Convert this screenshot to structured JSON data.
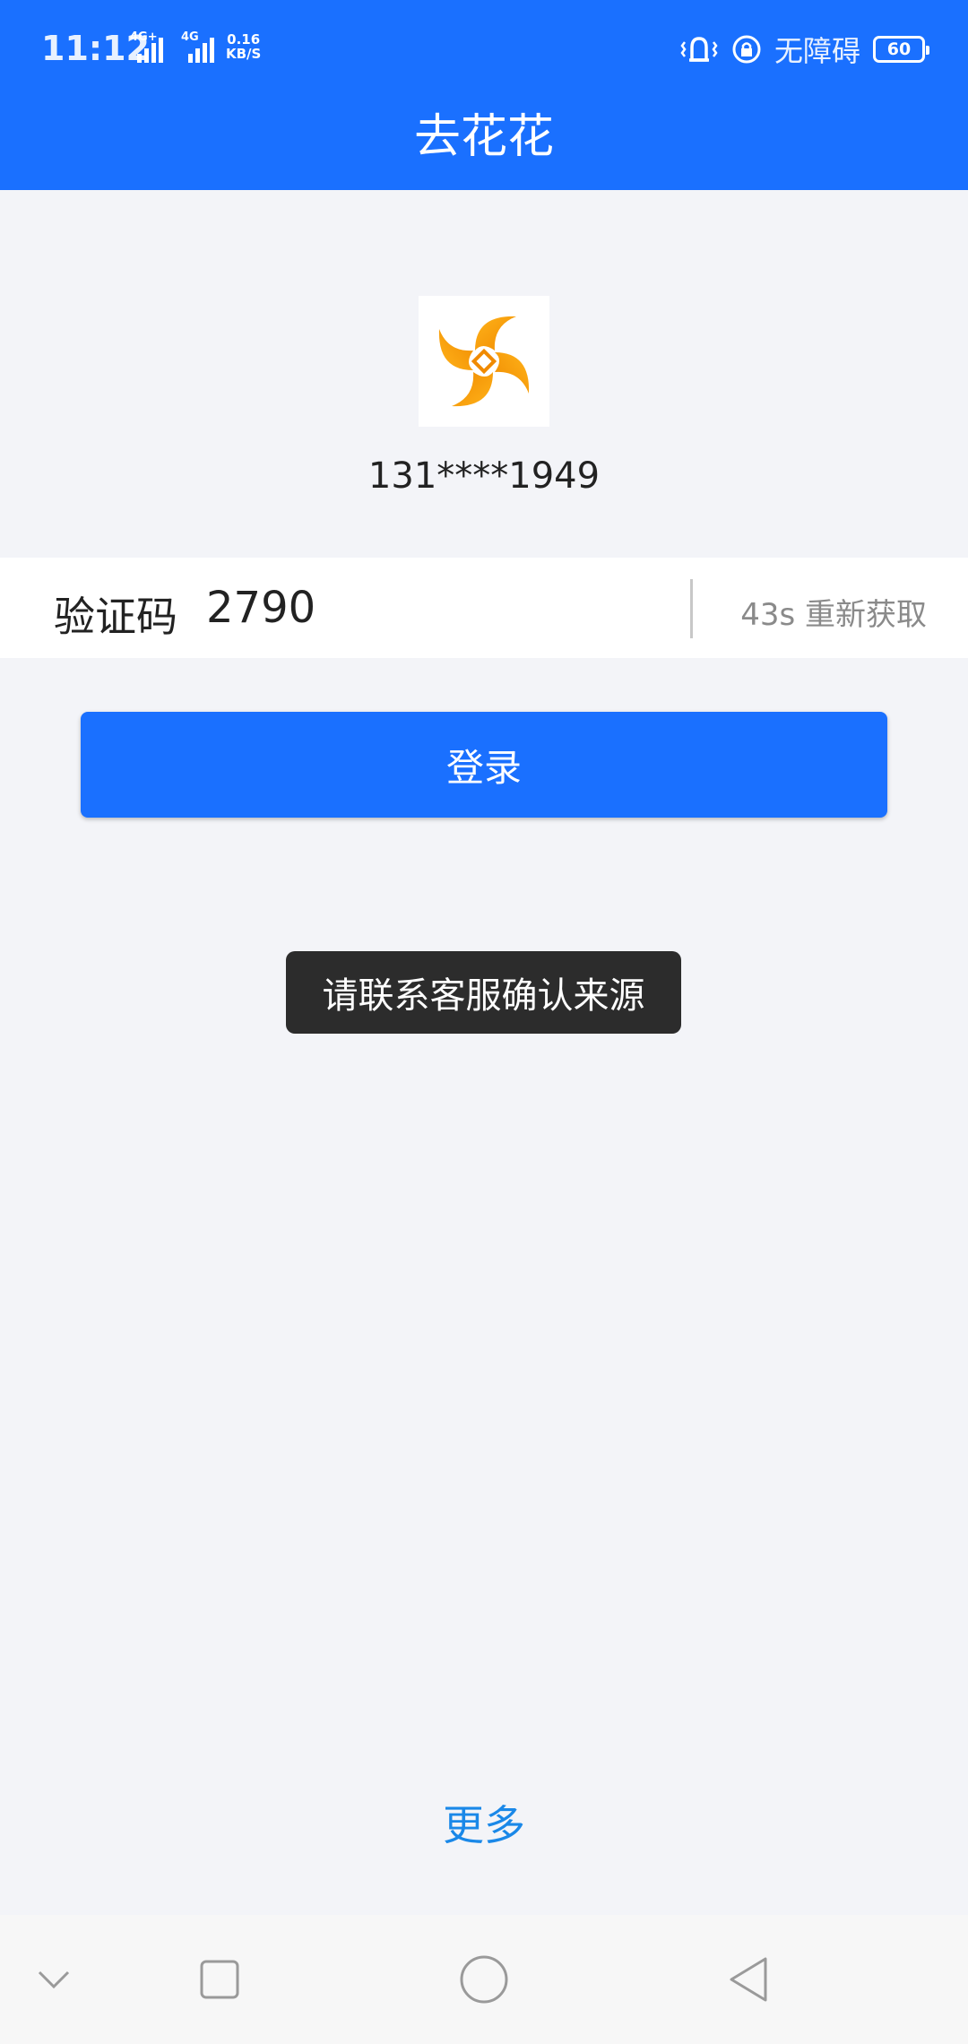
{
  "status_bar": {
    "time": "11:12",
    "network_1": "4G+",
    "network_2": "4G",
    "speed_value": "0.16",
    "speed_unit": "KB/S",
    "accessibility": "无障碍",
    "battery": "60"
  },
  "header": {
    "title": "去花花"
  },
  "account": {
    "phone_masked": "131****1949"
  },
  "verification": {
    "label": "验证码",
    "value": "2790",
    "resend": "43s 重新获取"
  },
  "login_button": {
    "label": "登录"
  },
  "toast": {
    "message": "请联系客服确认来源"
  },
  "footer": {
    "more_label": "更多"
  },
  "colors": {
    "primary": "#1a70ff",
    "link": "#1a88e8",
    "toast_bg": "#2c2c2c",
    "page_bg": "#f3f4f8"
  },
  "icons": {
    "vibrate": "vibrate-icon",
    "rotation_lock": "rotation-lock-icon",
    "logo": "app-logo-icon",
    "nav_hide": "chevron-down-icon",
    "nav_recents": "square-icon",
    "nav_home": "circle-icon",
    "nav_back": "triangle-back-icon"
  }
}
